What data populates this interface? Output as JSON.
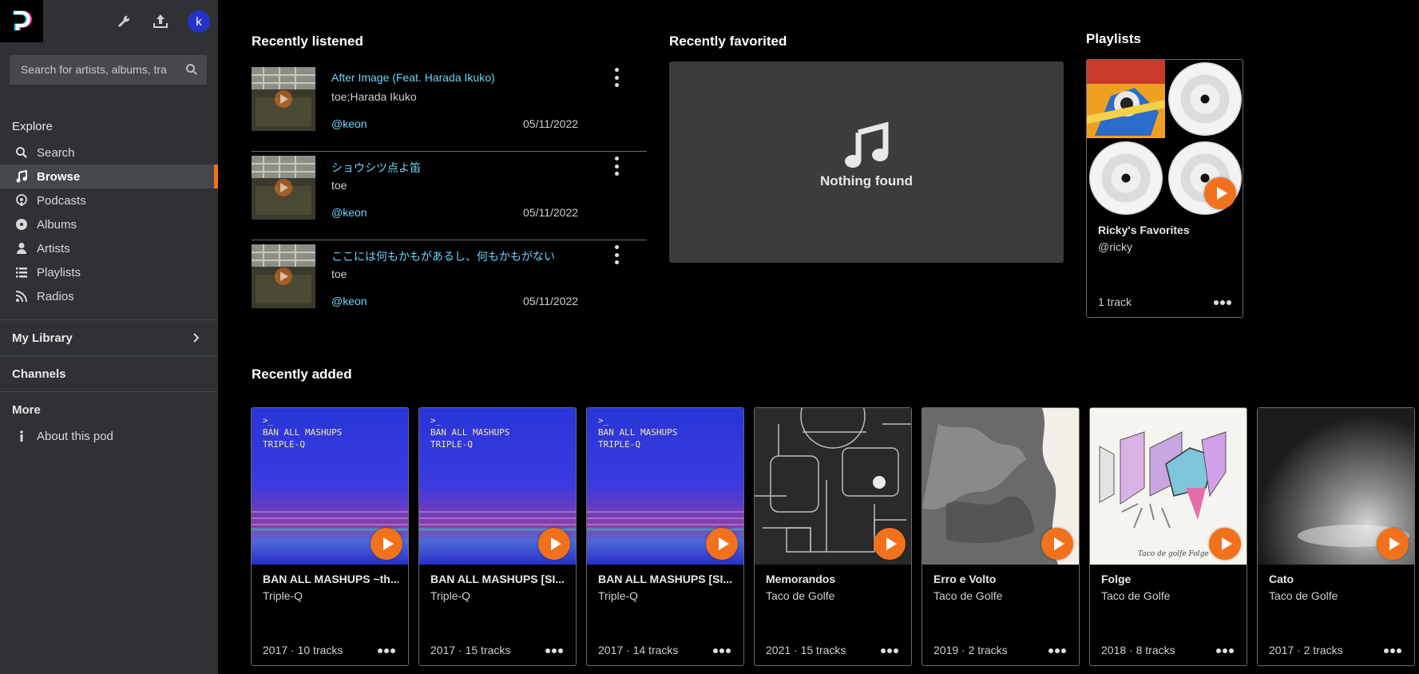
{
  "sidebar": {
    "avatar_letter": "k",
    "search_placeholder": "Search for artists, albums, tra",
    "explore_title": "Explore",
    "nav": [
      {
        "label": "Search",
        "icon": "search-icon"
      },
      {
        "label": "Browse",
        "icon": "music-note-icon",
        "active": true
      },
      {
        "label": "Podcasts",
        "icon": "podcast-icon"
      },
      {
        "label": "Albums",
        "icon": "disc-icon"
      },
      {
        "label": "Artists",
        "icon": "user-icon"
      },
      {
        "label": "Playlists",
        "icon": "list-icon"
      },
      {
        "label": "Radios",
        "icon": "feed-icon"
      }
    ],
    "my_library": "My Library",
    "channels": "Channels",
    "more": "More",
    "about": "About this pod"
  },
  "recently_listened": {
    "title": "Recently listened",
    "items": [
      {
        "title": "After Image (Feat. Harada Ikuko)",
        "artist": "toe;Harada Ikuko",
        "user": "@keon",
        "date": "05/11/2022"
      },
      {
        "title": "ショウシツ点よ笛",
        "artist": "toe",
        "user": "@keon",
        "date": "05/11/2022"
      },
      {
        "title": "ここには何もかもがあるし、何もかもがない",
        "artist": "toe",
        "user": "@keon",
        "date": "05/11/2022"
      }
    ]
  },
  "recently_favorited": {
    "title": "Recently favorited",
    "empty_text": "Nothing found"
  },
  "playlists": {
    "title": "Playlists",
    "items": [
      {
        "name": "Ricky's Favorites",
        "owner": "@ricky",
        "tracks": "1 track"
      }
    ]
  },
  "recently_added": {
    "title": "Recently added",
    "albums": [
      {
        "title": "BAN ALL MASHUPS ~th...",
        "artist": "Triple-Q",
        "meta": "2017 · 10 tracks",
        "cover_text": [
          ">_",
          "BAN ALL MASHUPS",
          "TRIPLE-Q"
        ]
      },
      {
        "title": "BAN ALL MASHUPS [SI...",
        "artist": "Triple-Q",
        "meta": "2017 · 15 tracks",
        "cover_text": [
          ">_",
          "BAN ALL MASHUPS",
          "TRIPLE-Q"
        ]
      },
      {
        "title": "BAN ALL MASHUPS [SI...",
        "artist": "Triple-Q",
        "meta": "2017 · 14 tracks",
        "cover_text": [
          ">_",
          "BAN ALL MASHUPS",
          "TRIPLE-Q"
        ]
      },
      {
        "title": "Memorandos",
        "artist": "Taco de Golfe",
        "meta": "2021 · 15 tracks"
      },
      {
        "title": "Erro e Volto",
        "artist": "Taco de Golfe",
        "meta": "2019 · 2 tracks"
      },
      {
        "title": "Folge",
        "artist": "Taco de Golfe",
        "meta": "2018 · 8 tracks",
        "cover_text": [
          "Taco de golfe  Folge"
        ]
      },
      {
        "title": "Cato",
        "artist": "Taco de Golfe",
        "meta": "2017 · 2 tracks"
      }
    ]
  },
  "colors": {
    "accent": "#f2711c",
    "link": "#6fd3f7",
    "sidebar_bg": "#2f3134"
  }
}
